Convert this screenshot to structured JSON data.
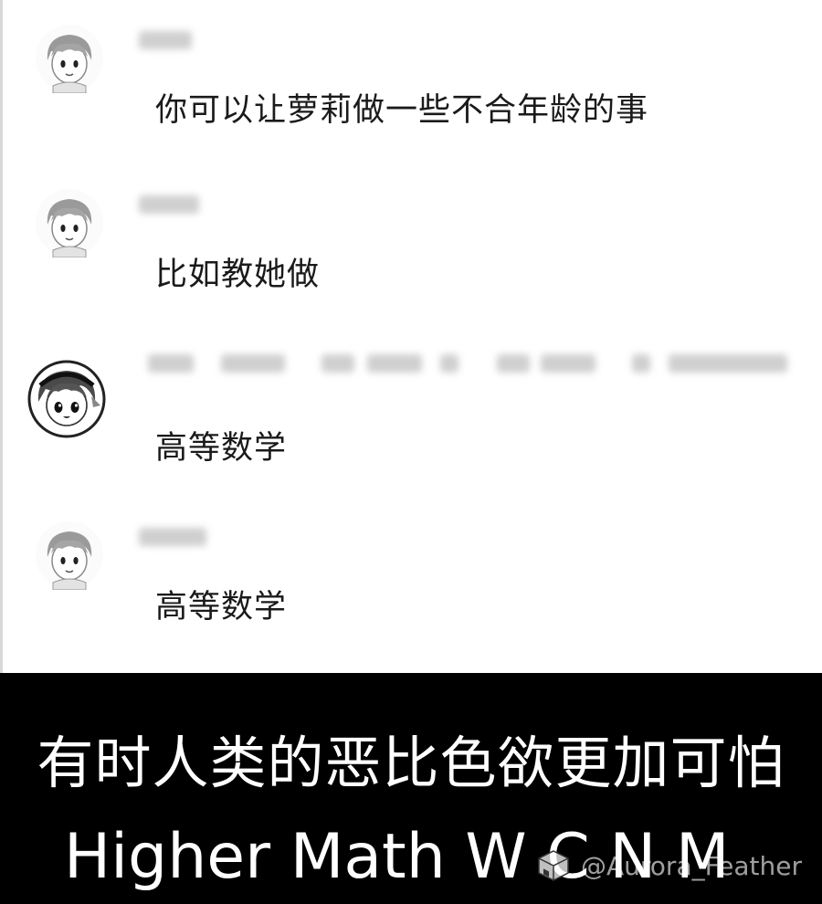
{
  "messages": [
    {
      "text": "你可以让萝莉做一些不合年龄的事",
      "avatar": "boy-avatar-icon"
    },
    {
      "text": "比如教她做",
      "avatar": "boy-avatar-icon"
    },
    {
      "text": "高等数学",
      "avatar": "girl-headband-avatar-icon"
    },
    {
      "text": "高等数学",
      "avatar": "boy-avatar-icon"
    }
  ],
  "caption": {
    "chinese": "有时人类的恶比色欲更加可怕",
    "english": "Higher Math W C N M"
  },
  "watermark": {
    "text": "@Aurora_Feather",
    "icon": "package-box-icon"
  },
  "colors": {
    "chat_background": "#ffffff",
    "caption_background": "#000000",
    "caption_text": "#ffffff",
    "message_text": "#1a1a1a"
  }
}
